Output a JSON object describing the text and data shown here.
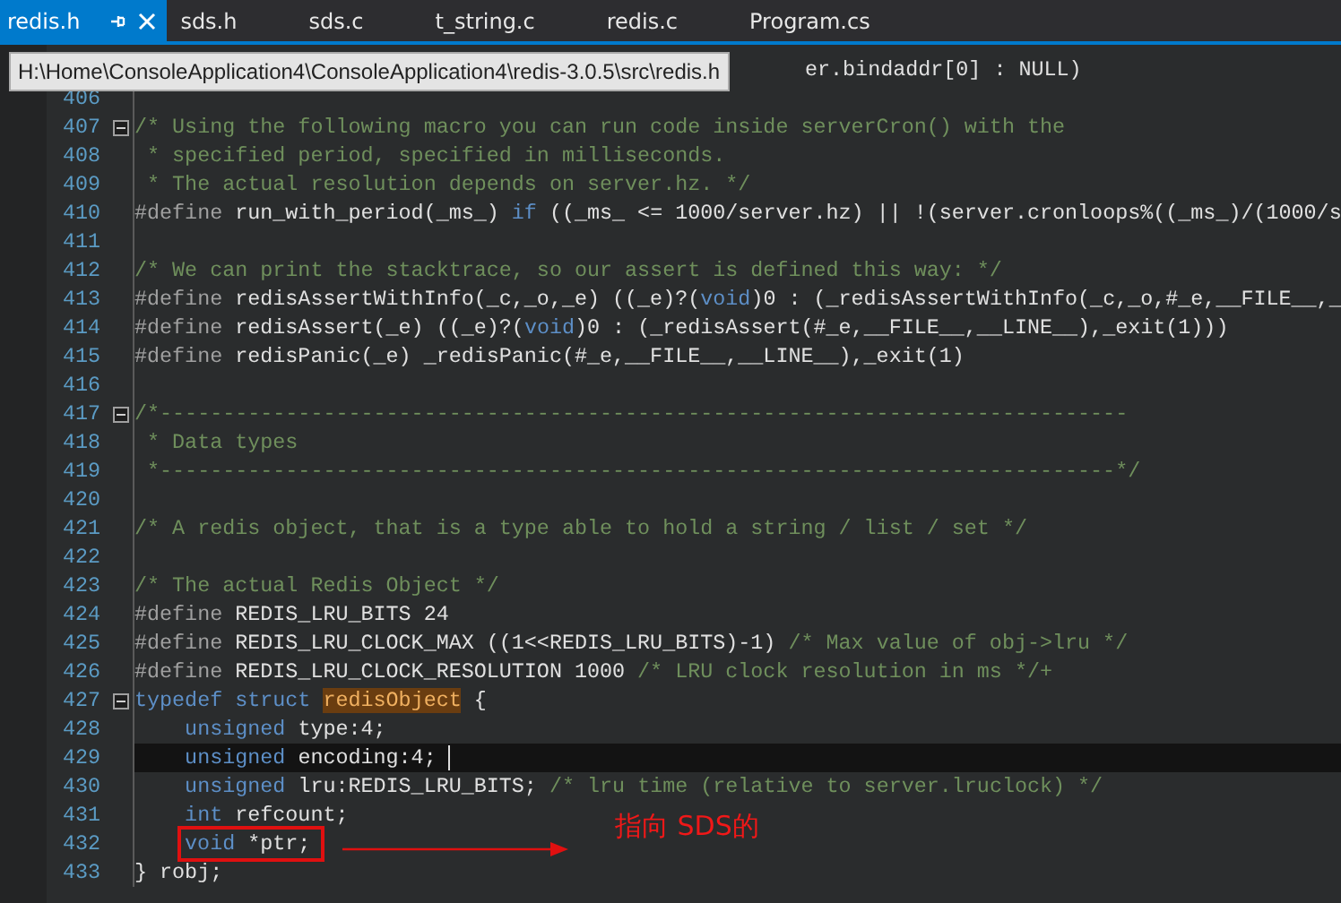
{
  "tabs": [
    {
      "label": "redis.h",
      "selected": true
    },
    {
      "label": "sds.h",
      "selected": false
    },
    {
      "label": "sds.c",
      "selected": false
    },
    {
      "label": "t_string.c",
      "selected": false
    },
    {
      "label": "redis.c",
      "selected": false
    },
    {
      "label": "Program.cs",
      "selected": false
    }
  ],
  "tooltip": "H:\\Home\\ConsoleApplication4\\ConsoleApplication4\\redis-3.0.5\\src\\redis.h",
  "lines": [
    {
      "covered": true,
      "tokens": [
        {
          "kind": "plain",
          "text": "er.bindaddr[0] : NULL)"
        }
      ]
    },
    {
      "number": "406"
    },
    {
      "number": "407",
      "fold": true,
      "tokens": [
        {
          "kind": "comment",
          "text": "/* Using the following macro you can run code inside serverCron() with the"
        }
      ]
    },
    {
      "number": "408",
      "tokens": [
        {
          "kind": "comment",
          "text": " * specified period, specified in milliseconds."
        }
      ]
    },
    {
      "number": "409",
      "tokens": [
        {
          "kind": "comment",
          "text": " * The actual resolution depends on server.hz. */"
        }
      ]
    },
    {
      "number": "410",
      "tokens": [
        {
          "kind": "preproc",
          "text": "#define "
        },
        {
          "kind": "plain",
          "text": "run_with_period(_ms_) "
        },
        {
          "kind": "keyword",
          "text": "if"
        },
        {
          "kind": "plain",
          "text": " ((_ms_ <= 1000/server.hz) || !(server.cronloops%((_ms_)/(1000/s"
        }
      ]
    },
    {
      "number": "411"
    },
    {
      "number": "412",
      "tokens": [
        {
          "kind": "comment",
          "text": "/* We can print the stacktrace, so our assert is defined this way: */"
        }
      ]
    },
    {
      "number": "413",
      "tokens": [
        {
          "kind": "preproc",
          "text": "#define "
        },
        {
          "kind": "plain",
          "text": "redisAssertWithInfo(_c,_o,_e) ((_e)?("
        },
        {
          "kind": "keyword",
          "text": "void"
        },
        {
          "kind": "plain",
          "text": ")0 : (_redisAssertWithInfo(_c,_o,#_e,__FILE__,_"
        }
      ]
    },
    {
      "number": "414",
      "tokens": [
        {
          "kind": "preproc",
          "text": "#define "
        },
        {
          "kind": "plain",
          "text": "redisAssert(_e) ((_e)?("
        },
        {
          "kind": "keyword",
          "text": "void"
        },
        {
          "kind": "plain",
          "text": ")0 : (_redisAssert(#_e,__FILE__,__LINE__),_exit(1)))"
        }
      ]
    },
    {
      "number": "415",
      "tokens": [
        {
          "kind": "preproc",
          "text": "#define "
        },
        {
          "kind": "plain",
          "text": "redisPanic(_e) _redisPanic(#_e,__FILE__,__LINE__),_exit(1)"
        }
      ]
    },
    {
      "number": "416"
    },
    {
      "number": "417",
      "fold": true,
      "tokens": [
        {
          "kind": "comment",
          "text": "/*-----------------------------------------------------------------------------"
        }
      ]
    },
    {
      "number": "418",
      "tokens": [
        {
          "kind": "comment",
          "text": " * Data types"
        }
      ]
    },
    {
      "number": "419",
      "tokens": [
        {
          "kind": "comment",
          "text": " *----------------------------------------------------------------------------*/"
        }
      ]
    },
    {
      "number": "420"
    },
    {
      "number": "421",
      "tokens": [
        {
          "kind": "comment",
          "text": "/* A redis object, that is a type able to hold a string / list / set */"
        }
      ]
    },
    {
      "number": "422"
    },
    {
      "number": "423",
      "tokens": [
        {
          "kind": "comment",
          "text": "/* The actual Redis Object */"
        }
      ]
    },
    {
      "number": "424",
      "tokens": [
        {
          "kind": "preproc",
          "text": "#define "
        },
        {
          "kind": "plain",
          "text": "REDIS_LRU_BITS 24"
        }
      ]
    },
    {
      "number": "425",
      "tokens": [
        {
          "kind": "preproc",
          "text": "#define "
        },
        {
          "kind": "plain",
          "text": "REDIS_LRU_CLOCK_MAX ((1<<REDIS_LRU_BITS)-1) "
        },
        {
          "kind": "comment",
          "text": "/* Max value of obj->lru */"
        }
      ]
    },
    {
      "number": "426",
      "tokens": [
        {
          "kind": "preproc",
          "text": "#define "
        },
        {
          "kind": "plain",
          "text": "REDIS_LRU_CLOCK_RESOLUTION 1000 "
        },
        {
          "kind": "comment",
          "text": "/* LRU clock resolution in ms */+"
        }
      ]
    },
    {
      "number": "427",
      "fold": true,
      "tokens": [
        {
          "kind": "keyword",
          "text": "typedef struct "
        },
        {
          "kind": "match",
          "text": "redisObject"
        },
        {
          "kind": "plain",
          "text": " {"
        }
      ]
    },
    {
      "number": "428",
      "tokens": [
        {
          "kind": "keyword",
          "text": "    unsigned "
        },
        {
          "kind": "plain",
          "text": "type:4;"
        }
      ]
    },
    {
      "number": "429",
      "current": true,
      "tokens": [
        {
          "kind": "keyword",
          "text": "    unsigned "
        },
        {
          "kind": "plain",
          "text": "encoding:4;"
        }
      ]
    },
    {
      "number": "430",
      "tokens": [
        {
          "kind": "keyword",
          "text": "    unsigned "
        },
        {
          "kind": "plain",
          "text": "lru:REDIS_LRU_BITS; "
        },
        {
          "kind": "comment",
          "text": "/* lru time (relative to server.lruclock) */"
        }
      ]
    },
    {
      "number": "431",
      "tokens": [
        {
          "kind": "keyword",
          "text": "    int "
        },
        {
          "kind": "plain",
          "text": "refcount;"
        }
      ]
    },
    {
      "number": "432",
      "boxed": true,
      "tokens": [
        {
          "kind": "keyword",
          "text": "void "
        },
        {
          "kind": "plain",
          "text": "*ptr;"
        }
      ]
    },
    {
      "number": "433",
      "tokens": [
        {
          "kind": "plain",
          "text": "} robj;"
        }
      ]
    }
  ],
  "annotation": "指向 SDS的"
}
